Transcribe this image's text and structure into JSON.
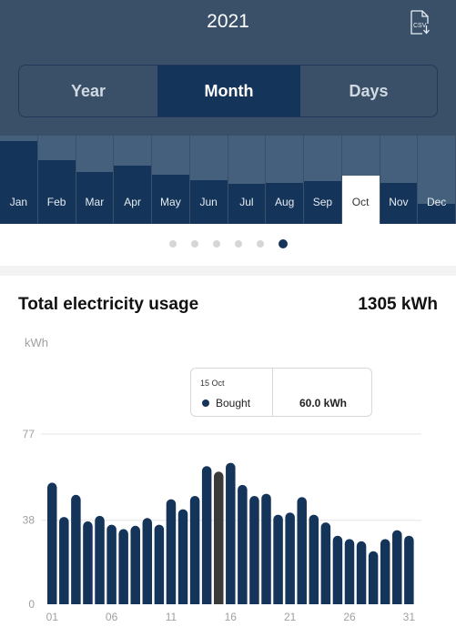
{
  "header": {
    "year": "2021",
    "csv_icon": "csv-download-icon",
    "tabs": [
      {
        "label": "Year",
        "active": false
      },
      {
        "label": "Month",
        "active": true
      },
      {
        "label": "Days",
        "active": false
      }
    ]
  },
  "months": [
    {
      "label": "Jan",
      "level": 0.94,
      "selected": false
    },
    {
      "label": "Feb",
      "level": 0.72,
      "selected": false
    },
    {
      "label": "Mar",
      "level": 0.59,
      "selected": false
    },
    {
      "label": "Apr",
      "level": 0.66,
      "selected": false
    },
    {
      "label": "May",
      "level": 0.56,
      "selected": false
    },
    {
      "label": "Jun",
      "level": 0.49,
      "selected": false
    },
    {
      "label": "Jul",
      "level": 0.45,
      "selected": false
    },
    {
      "label": "Aug",
      "level": 0.46,
      "selected": false
    },
    {
      "label": "Sep",
      "level": 0.48,
      "selected": false
    },
    {
      "label": "Oct",
      "level": 0.54,
      "selected": true
    },
    {
      "label": "Nov",
      "level": 0.46,
      "selected": false
    },
    {
      "label": "Dec",
      "level": 0.23,
      "selected": false
    }
  ],
  "pager": {
    "count": 6,
    "active_index": 5
  },
  "summary": {
    "title": "Total electricity usage",
    "total": "1305 kWh",
    "unit_label": "kWh"
  },
  "tooltip": {
    "date": "15 Oct",
    "series": "Bought",
    "value": "60.0 kWh"
  },
  "colors": {
    "bar": "#14345a",
    "bar_selected": "#3a3a3a",
    "header_bg": "#3a5068"
  },
  "chart_data": {
    "type": "bar",
    "title": "Total electricity usage",
    "ylabel": "kWh",
    "xlabel": "",
    "ylim": [
      0,
      77
    ],
    "yticks": [
      0,
      38,
      77
    ],
    "xtick_labels": [
      "01",
      "06",
      "11",
      "16",
      "21",
      "26",
      "31"
    ],
    "categories": [
      "01",
      "02",
      "03",
      "04",
      "05",
      "06",
      "07",
      "08",
      "09",
      "10",
      "11",
      "12",
      "13",
      "14",
      "15",
      "16",
      "17",
      "18",
      "19",
      "20",
      "21",
      "22",
      "23",
      "24",
      "25",
      "26",
      "27",
      "28",
      "29",
      "30",
      "31"
    ],
    "series": [
      {
        "name": "Bought",
        "values": [
          55,
          39.5,
          49.5,
          37.5,
          40,
          36,
          34,
          35.5,
          39,
          36,
          47.5,
          43,
          49,
          62.5,
          60,
          64,
          54,
          49,
          50,
          40.5,
          41.5,
          48.5,
          40.5,
          37,
          31,
          29.5,
          28.5,
          24,
          29.5,
          33.5,
          31
        ]
      }
    ],
    "highlighted_index": 14,
    "grid": true,
    "legend": "none"
  }
}
